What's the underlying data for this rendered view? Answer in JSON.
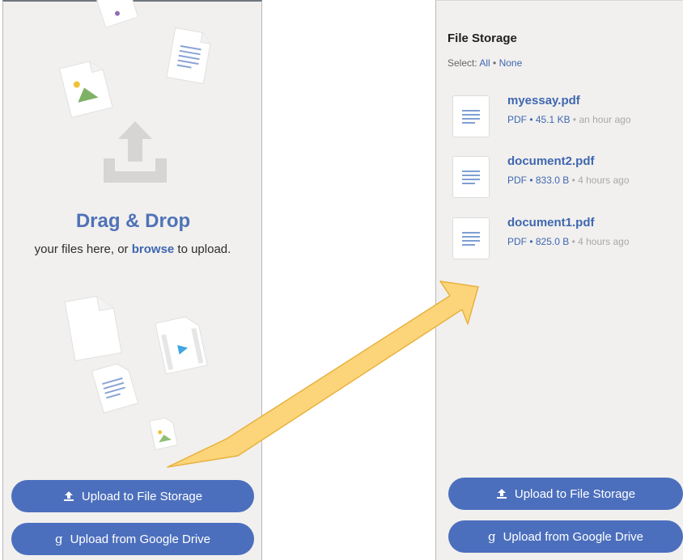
{
  "left_panel": {
    "drop_title": "Drag & Drop",
    "drop_text_before": "your files here, or ",
    "browse_label": "browse",
    "drop_text_after": " to upload.",
    "upload_storage_label": "Upload to File Storage",
    "upload_drive_label": "Upload from Google Drive",
    "upload_icon": "upload-icon",
    "drive_icon": "google-g-icon"
  },
  "right_panel": {
    "title": "File Storage",
    "select_label": "Select:",
    "select_all": "All",
    "select_sep": "•",
    "select_none": "None",
    "files": [
      {
        "name": "myessay.pdf",
        "type": "PDF",
        "size": "45.1 KB",
        "time": "an hour ago"
      },
      {
        "name": "document2.pdf",
        "type": "PDF",
        "size": "833.0 B",
        "time": "4 hours ago"
      },
      {
        "name": "document1.pdf",
        "type": "PDF",
        "size": "825.0 B",
        "time": "4 hours ago"
      }
    ],
    "upload_storage_label": "Upload to File Storage",
    "upload_drive_label": "Upload from Google Drive"
  },
  "colors": {
    "accent": "#4c6fbd",
    "link": "#3f67b0",
    "panel_bg": "#f1f0ee",
    "arrow_fill": "#fcd57a",
    "arrow_stroke": "#e8b13f"
  }
}
